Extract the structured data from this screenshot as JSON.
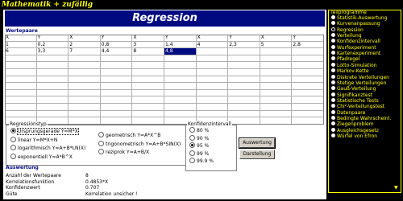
{
  "window_title": "Mathematik + zufällig",
  "banner": "Regression",
  "wertepaare": {
    "title": "Wertepaare",
    "headers": [
      "X",
      "Y",
      "X",
      "Y",
      "X",
      "Y",
      "X",
      "Y",
      "X",
      "Y"
    ],
    "rows": [
      [
        "1",
        "0,2",
        "2",
        "0,8",
        "3",
        "1,4",
        "4",
        "2,3",
        "5",
        "2,8"
      ],
      [
        "6",
        "3,3",
        "7",
        "4,4",
        "8",
        "4,8",
        "",
        "",
        "",
        ""
      ],
      [
        "",
        "",
        "",
        "",
        "",
        "",
        "",
        "",
        "",
        ""
      ],
      [
        "",
        "",
        "",
        "",
        "",
        "",
        "",
        "",
        "",
        ""
      ],
      [
        "",
        "",
        "",
        "",
        "",
        "",
        "",
        "",
        "",
        ""
      ],
      [
        "",
        "",
        "",
        "",
        "",
        "",
        "",
        "",
        "",
        ""
      ],
      [
        "",
        "",
        "",
        "",
        "",
        "",
        "",
        "",
        "",
        ""
      ],
      [
        "",
        "",
        "",
        "",
        "",
        "",
        "",
        "",
        "",
        ""
      ],
      [
        "",
        "",
        "",
        "",
        "",
        "",
        "",
        "",
        "",
        ""
      ],
      [
        "",
        "",
        "",
        "",
        "",
        "",
        "",
        "",
        "",
        ""
      ],
      [
        "",
        "",
        "",
        "",
        "",
        "",
        "",
        "",
        "",
        ""
      ],
      [
        "",
        "",
        "",
        "",
        "",
        "",
        "",
        "",
        "",
        ""
      ]
    ],
    "selected_cell": "row 1, column 6"
  },
  "regressionstyp": {
    "title": "Regressionstyp",
    "selected": "Ursprungsgerade Y=M*X",
    "options_left": [
      "Ursprungsgerade Y=M*X",
      "linear Y=M*X+N",
      "logarithmisch Y=A+B*LN(X)",
      "exponentiell Y=A*B^X"
    ],
    "options_right": [
      "geometrisch Y=A*X^B",
      "trigonometrisch Y=A+B*SIN(X)",
      "reziprok Y=A+B/X"
    ]
  },
  "konfidenzintervall": {
    "title": "Konfidenzintervall",
    "selected": "95 %",
    "options": [
      "80 %",
      "90 %",
      "95 %",
      "99 %",
      "99.9 %"
    ]
  },
  "buttons": {
    "auswertung": "Auswertung",
    "darstellung": "Darstellung"
  },
  "auswertung": {
    "title": "Auswertung",
    "rows": [
      {
        "label": "Anzahl der Wertepaare",
        "value": "8"
      },
      {
        "label": "Korrelationsfunktion",
        "value": "0.4853*X"
      },
      {
        "label": "Konfidenzwert",
        "value": "0.707"
      },
      {
        "label": "Güte",
        "value": "Korrelation unsicher !"
      }
    ]
  },
  "sidebar": {
    "title": "Teilprogramme",
    "selected": "Regression",
    "items": [
      "Statistik-Auswertung",
      "Kurvenanpassung",
      "Regression",
      "Verteilung",
      "Konfidenzintervall",
      "Wurfexperiment",
      "Kartenexperiment",
      "Pfadregel",
      "Lotto-Simulation",
      "Markov-Kette",
      "Diskrete Verteilungen",
      "Stetige Verteilungen",
      "Gauß-Verteilung",
      "Signifikanztest",
      "Statistische Tests",
      "Chi²-Verteilungstest",
      "Datenpaare",
      "Bedingte Wahrscheinl.",
      "Ziegenproblem",
      "Ausgleichsgesetz",
      "Würfel von Efron"
    ]
  },
  "colors": {
    "banner": "#000a80",
    "accent": "#ffff00",
    "selection": "#000a80"
  }
}
